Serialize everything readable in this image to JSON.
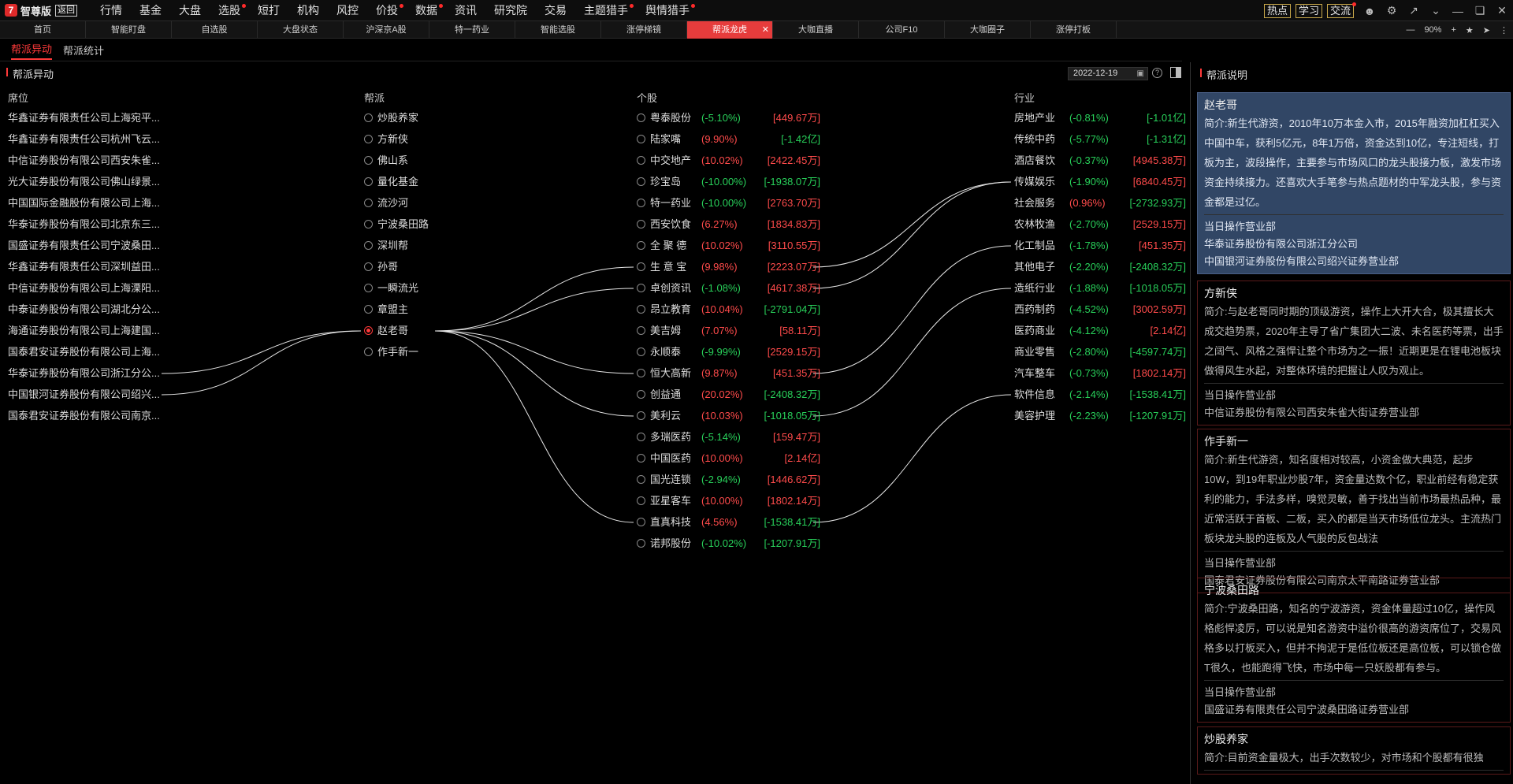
{
  "app": {
    "logo_mark": "7",
    "logo_text": "智尊版",
    "logo_badge": "返回"
  },
  "menu": [
    {
      "label": "行情",
      "dot": false
    },
    {
      "label": "基金",
      "dot": false
    },
    {
      "label": "大盘",
      "dot": false
    },
    {
      "label": "选股",
      "dot": true
    },
    {
      "label": "短打",
      "dot": false
    },
    {
      "label": "机构",
      "dot": false
    },
    {
      "label": "风控",
      "dot": false
    },
    {
      "label": "价投",
      "dot": true
    },
    {
      "label": "数据",
      "dot": true
    },
    {
      "label": "资讯",
      "dot": false
    },
    {
      "label": "研究院",
      "dot": false
    },
    {
      "label": "交易",
      "dot": false
    },
    {
      "label": "主题猎手",
      "dot": true
    },
    {
      "label": "舆情猎手",
      "dot": true
    }
  ],
  "top_right": {
    "btn1": "热点",
    "btn2": "学习",
    "btn3": "交流"
  },
  "tabs": [
    "首页",
    "智能盯盘",
    "自选股",
    "大盘状态",
    "沪深京A股",
    "特一药业",
    "智能选股",
    "涨停梯镜",
    "帮派龙虎",
    "大咖直播",
    "公司F10",
    "大咖圈子",
    "涨停打板"
  ],
  "active_tab": 8,
  "zoom": "90%",
  "subtabs": [
    "帮派异动",
    "帮派统计"
  ],
  "section_title": "帮派异动",
  "date": "2022-12-19",
  "columns": {
    "seat": "席位",
    "faction": "帮派",
    "stock": "个股",
    "industry": "行业"
  },
  "seats": [
    "华鑫证券有限责任公司上海宛平...",
    "华鑫证券有限责任公司杭州飞云...",
    "中信证券股份有限公司西安朱雀...",
    "光大证券股份有限公司佛山绿景...",
    "中国国际金融股份有限公司上海...",
    "华泰证券股份有限公司北京东三...",
    "国盛证券有限责任公司宁波桑田...",
    "华鑫证券有限责任公司深圳益田...",
    "中信证券股份有限公司上海溧阳...",
    "中泰证券股份有限公司湖北分公...",
    "海通证券股份有限公司上海建国...",
    "国泰君安证券股份有限公司上海...",
    "华泰证券股份有限公司浙江分公...",
    "中国银河证券股份有限公司绍兴...",
    "国泰君安证券股份有限公司南京..."
  ],
  "factions": [
    "炒股养家",
    "方新侠",
    "佛山系",
    "量化基金",
    "流沙河",
    "宁波桑田路",
    "深圳帮",
    "孙哥",
    "一瞬流光",
    "章盟主",
    "赵老哥",
    "作手新一"
  ],
  "selected_faction": 10,
  "stocks": [
    {
      "name": "粤泰股份",
      "pct": "(-5.10%)",
      "pc": "green",
      "amt": "[449.67万]",
      "ac": "red"
    },
    {
      "name": "陆家嘴",
      "pct": "(9.90%)",
      "pc": "red",
      "amt": "[-1.42亿]",
      "ac": "green"
    },
    {
      "name": "中交地产",
      "pct": "(10.02%)",
      "pc": "red",
      "amt": "[2422.45万]",
      "ac": "red"
    },
    {
      "name": "珍宝岛",
      "pct": "(-10.00%)",
      "pc": "green",
      "amt": "[-1938.07万]",
      "ac": "green"
    },
    {
      "name": "特一药业",
      "pct": "(-10.00%)",
      "pc": "green",
      "amt": "[2763.70万]",
      "ac": "red"
    },
    {
      "name": "西安饮食",
      "pct": "(6.27%)",
      "pc": "red",
      "amt": "[1834.83万]",
      "ac": "red"
    },
    {
      "name": "全 聚 德",
      "pct": "(10.02%)",
      "pc": "red",
      "amt": "[3110.55万]",
      "ac": "red"
    },
    {
      "name": "生 意 宝",
      "pct": "(9.98%)",
      "pc": "red",
      "amt": "[2223.07万]",
      "ac": "red"
    },
    {
      "name": "卓创资讯",
      "pct": "(-1.08%)",
      "pc": "green",
      "amt": "[4617.38万]",
      "ac": "red"
    },
    {
      "name": "昂立教育",
      "pct": "(10.04%)",
      "pc": "red",
      "amt": "[-2791.04万]",
      "ac": "green"
    },
    {
      "name": "美吉姆",
      "pct": "(7.07%)",
      "pc": "red",
      "amt": "[58.11万]",
      "ac": "red"
    },
    {
      "name": "永顺泰",
      "pct": "(-9.99%)",
      "pc": "green",
      "amt": "[2529.15万]",
      "ac": "red"
    },
    {
      "name": "恒大高新",
      "pct": "(9.87%)",
      "pc": "red",
      "amt": "[451.35万]",
      "ac": "red"
    },
    {
      "name": "创益通",
      "pct": "(20.02%)",
      "pc": "red",
      "amt": "[-2408.32万]",
      "ac": "green"
    },
    {
      "name": "美利云",
      "pct": "(10.03%)",
      "pc": "red",
      "amt": "[-1018.05万]",
      "ac": "green"
    },
    {
      "name": "多瑞医药",
      "pct": "(-5.14%)",
      "pc": "green",
      "amt": "[159.47万]",
      "ac": "red"
    },
    {
      "name": "中国医药",
      "pct": "(10.00%)",
      "pc": "red",
      "amt": "[2.14亿]",
      "ac": "red"
    },
    {
      "name": "国光连锁",
      "pct": "(-2.94%)",
      "pc": "green",
      "amt": "[1446.62万]",
      "ac": "red"
    },
    {
      "name": "亚星客车",
      "pct": "(10.00%)",
      "pc": "red",
      "amt": "[1802.14万]",
      "ac": "red"
    },
    {
      "name": "直真科技",
      "pct": "(4.56%)",
      "pc": "red",
      "amt": "[-1538.41万]",
      "ac": "green"
    },
    {
      "name": "诺邦股份",
      "pct": "(-10.02%)",
      "pc": "green",
      "amt": "[-1207.91万]",
      "ac": "green"
    }
  ],
  "industries": [
    {
      "name": "房地产业",
      "pct": "(-0.81%)",
      "pc": "green",
      "amt": "[-1.01亿]",
      "ac": "green"
    },
    {
      "name": "传统中药",
      "pct": "(-5.77%)",
      "pc": "green",
      "amt": "[-1.31亿]",
      "ac": "green"
    },
    {
      "name": "酒店餐饮",
      "pct": "(-0.37%)",
      "pc": "green",
      "amt": "[4945.38万]",
      "ac": "red"
    },
    {
      "name": "传媒娱乐",
      "pct": "(-1.90%)",
      "pc": "green",
      "amt": "[6840.45万]",
      "ac": "red"
    },
    {
      "name": "社会服务",
      "pct": "(0.96%)",
      "pc": "red",
      "amt": "[-2732.93万]",
      "ac": "green"
    },
    {
      "name": "农林牧渔",
      "pct": "(-2.70%)",
      "pc": "green",
      "amt": "[2529.15万]",
      "ac": "red"
    },
    {
      "name": "化工制品",
      "pct": "(-1.78%)",
      "pc": "green",
      "amt": "[451.35万]",
      "ac": "red"
    },
    {
      "name": "其他电子",
      "pct": "(-2.20%)",
      "pc": "green",
      "amt": "[-2408.32万]",
      "ac": "green"
    },
    {
      "name": "造纸行业",
      "pct": "(-1.88%)",
      "pc": "green",
      "amt": "[-1018.05万]",
      "ac": "green"
    },
    {
      "name": "西药制药",
      "pct": "(-4.52%)",
      "pc": "green",
      "amt": "[3002.59万]",
      "ac": "red"
    },
    {
      "name": "医药商业",
      "pct": "(-4.12%)",
      "pc": "green",
      "amt": "[2.14亿]",
      "ac": "red"
    },
    {
      "name": "商业零售",
      "pct": "(-2.80%)",
      "pc": "green",
      "amt": "[-4597.74万]",
      "ac": "green"
    },
    {
      "name": "汽车整车",
      "pct": "(-0.73%)",
      "pc": "green",
      "amt": "[1802.14万]",
      "ac": "red"
    },
    {
      "name": "软件信息",
      "pct": "(-2.14%)",
      "pc": "green",
      "amt": "[-1538.41万]",
      "ac": "green"
    },
    {
      "name": "美容护理",
      "pct": "(-2.23%)",
      "pc": "green",
      "amt": "[-1207.91万]",
      "ac": "green"
    }
  ],
  "links": {
    "seat_to_faction": [
      [
        12,
        10
      ],
      [
        13,
        10
      ]
    ],
    "faction_to_stock": [
      [
        10,
        7
      ],
      [
        10,
        8
      ],
      [
        10,
        12
      ],
      [
        10,
        14
      ],
      [
        10,
        19
      ]
    ],
    "stock_to_industry": [
      [
        7,
        3
      ],
      [
        8,
        3
      ],
      [
        12,
        6
      ],
      [
        14,
        8
      ],
      [
        19,
        13
      ]
    ]
  },
  "colors": {
    "accent": "#ff3a3a",
    "up": "#ff4b4b",
    "down": "#28d05a",
    "selected_card": "#314665"
  },
  "right_panel": {
    "title": "帮派说明",
    "cards": [
      {
        "name": "赵老哥",
        "desc": "简介:新生代游资，2010年10万本金入市，2015年融资加杠杠买入中国中车，获利5亿元，8年1万倍，资金达到10亿，专注短线，打板为主，波段操作，主要参与市场风口的龙头股接力板，激发市场资金持续接力。还喜欢大手笔参与热点题材的中军龙头股，参与资金都是过亿。",
        "label": "当日操作营业部",
        "branches": [
          "华泰证券股份有限公司浙江分公司",
          "中国银河证券股份有限公司绍兴证券营业部"
        ]
      },
      {
        "name": "方新侠",
        "desc": "简介:与赵老哥同时期的顶级游资，操作上大开大合，极其擅长大成交趋势票，2020年主导了省广集团大二波、未名医药等票，出手之阔气、风格之强悍让整个市场为之一振！近期更是在锂电池板块做得风生水起，对整体环境的把握让人叹为观止。",
        "label": "当日操作营业部",
        "branches": [
          "中信证券股份有限公司西安朱雀大街证券营业部"
        ]
      },
      {
        "name": "作手新一",
        "desc": "简介:新生代游资，知名度相对较高，小资金做大典范，起步10W，到19年职业炒股7年，资金量达数个亿，职业前经有稳定获利的能力，手法多样，嗅觉灵敏，善于找出当前市场最热品种，最近常活跃于首板、二板，买入的都是当天市场低位龙头。主流热门板块龙头股的连板及人气股的反包战法",
        "label": "当日操作营业部",
        "branches": [
          "国泰君安证券股份有限公司南京太平南路证券营业部"
        ]
      },
      {
        "name": "宁波桑田路",
        "desc": "简介:宁波桑田路，知名的宁波游资，资金体量超过10亿，操作风格彪悍凌厉，可以说是知名游资中溢价很高的游资席位了，交易风格多以打板买入，但并不拘泥于是低位板还是高位板，可以锁仓做T很久，也能跑得飞快，市场中每一只妖股都有参与。",
        "label": "当日操作营业部",
        "branches": [
          "国盛证券有限责任公司宁波桑田路证券营业部"
        ]
      },
      {
        "name": "炒股养家",
        "desc": "简介:目前资金量极大，出手次数较少，对市场和个股都有很独",
        "label": "",
        "branches": []
      }
    ]
  }
}
